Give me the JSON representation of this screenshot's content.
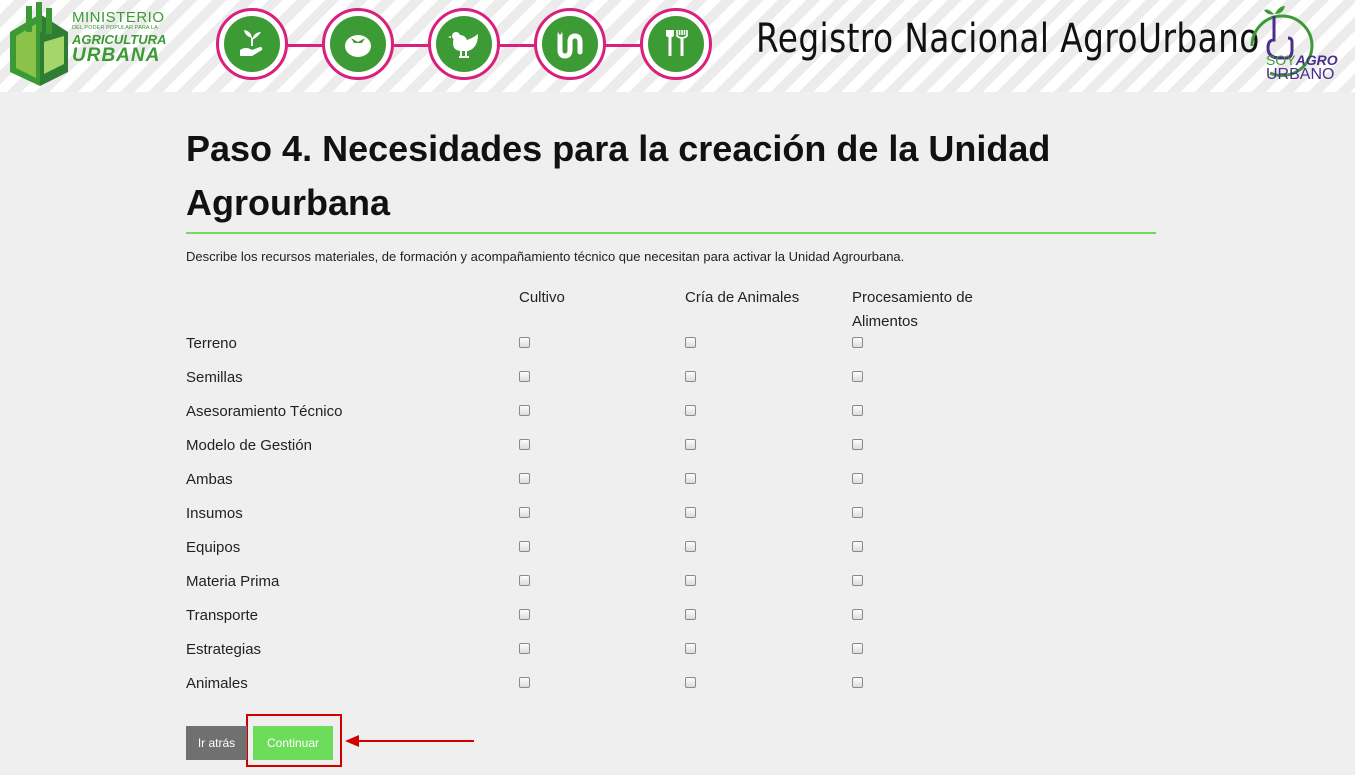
{
  "header": {
    "ministry": {
      "line1": "MINISTERIO",
      "line2": "DEL PODER POPULAR PARA LA",
      "line3": "AGRICULTURA",
      "line4": "URBANA"
    },
    "steps": [
      {
        "icon": "hand-plant-icon"
      },
      {
        "icon": "tomato-icon"
      },
      {
        "icon": "chicken-icon"
      },
      {
        "icon": "worm-icon"
      },
      {
        "icon": "tools-icon"
      }
    ],
    "title": "Registro Nacional AgroUrbano",
    "soy_logo": {
      "soy": "SOY",
      "agro": "AGRO",
      "urbano": "URBANO"
    }
  },
  "main": {
    "title": "Paso 4. Necesidades para la creación de la Unidad Agrourbana",
    "description": "Describe los recursos materiales, de formación y acompañamiento técnico que necesitan para activar la Unidad Agrourbana.",
    "columns": [
      "Cultivo",
      "Cría de Animales",
      "Procesamiento de Alimentos"
    ],
    "rows": [
      {
        "label": "Terreno",
        "checked": [
          false,
          false,
          false
        ]
      },
      {
        "label": "Semillas",
        "checked": [
          false,
          false,
          false
        ]
      },
      {
        "label": "Asesoramiento Técnico",
        "checked": [
          false,
          false,
          false
        ]
      },
      {
        "label": "Modelo de Gestión",
        "checked": [
          false,
          false,
          false
        ]
      },
      {
        "label": "Ambas",
        "checked": [
          false,
          false,
          false
        ]
      },
      {
        "label": "Insumos",
        "checked": [
          false,
          false,
          false
        ]
      },
      {
        "label": "Equipos",
        "checked": [
          false,
          false,
          false
        ]
      },
      {
        "label": "Materia Prima",
        "checked": [
          false,
          false,
          false
        ]
      },
      {
        "label": "Transporte",
        "checked": [
          false,
          false,
          false
        ]
      },
      {
        "label": "Estrategias",
        "checked": [
          false,
          false,
          false
        ]
      },
      {
        "label": "Animales",
        "checked": [
          false,
          false,
          false
        ]
      }
    ],
    "buttons": {
      "back": "Ir atrás",
      "continue": "Continuar"
    }
  },
  "colors": {
    "brand_green": "#3d9b36",
    "accent_green": "#6ddc5a",
    "magenta": "#d9207a",
    "purple": "#4b2f8c",
    "annotation_red": "#d10000"
  }
}
